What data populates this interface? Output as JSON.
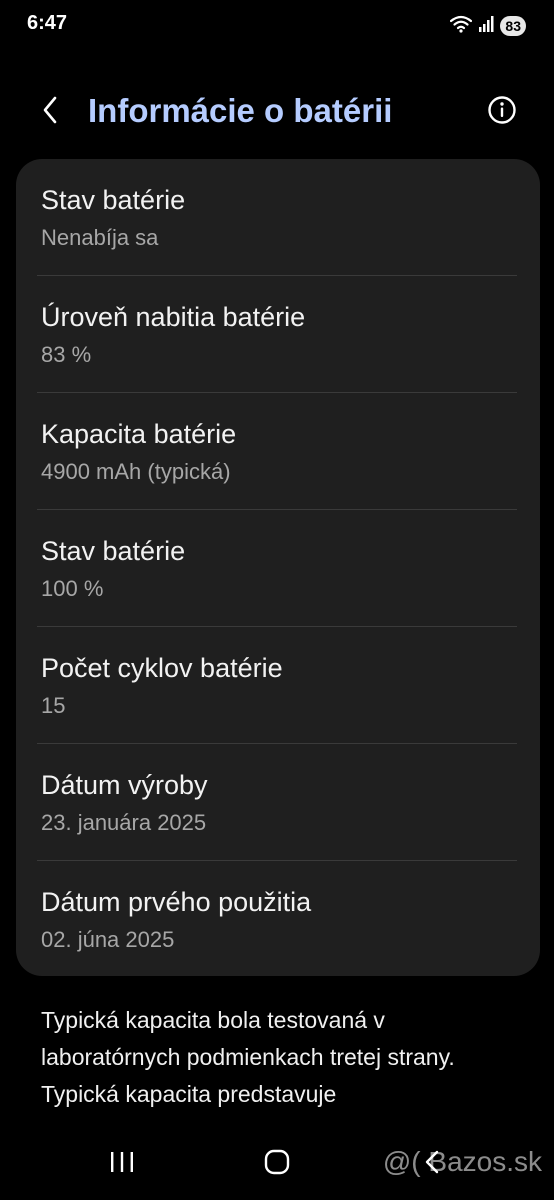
{
  "status_bar": {
    "time": "6:47",
    "battery_level": "83",
    "icons": [
      "wifi-icon",
      "signal-icon",
      "battery-icon"
    ]
  },
  "header": {
    "title": "Informácie o batérii",
    "back_icon": "chevron-left-icon",
    "info_icon": "info-circle-icon",
    "title_color": "#b5ccff"
  },
  "battery_info": [
    {
      "label": "Stav batérie",
      "value": "Nenabíja sa"
    },
    {
      "label": "Úroveň nabitia batérie",
      "value": "83 %"
    },
    {
      "label": "Kapacita batérie",
      "value": "4900 mAh (typická)"
    },
    {
      "label": "Stav batérie",
      "value": "100 %"
    },
    {
      "label": "Počet cyklov batérie",
      "value": "15"
    },
    {
      "label": "Dátum výroby",
      "value": "23. januára 2025"
    },
    {
      "label": "Dátum prvého použitia",
      "value": "02. júna 2025"
    }
  ],
  "footnote": "Typická kapacita bola testovaná v laboratórnych podmienkach tretej strany. Typická kapacita predstavuje",
  "nav_bar": {
    "icons": [
      "recents-icon",
      "home-icon",
      "back-icon"
    ],
    "watermark": "@( Bazos.sk"
  }
}
